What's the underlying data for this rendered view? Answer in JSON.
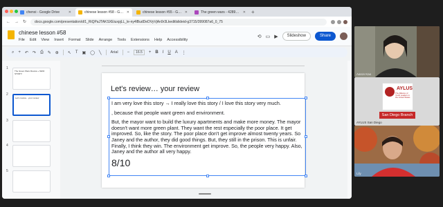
{
  "browser": {
    "tabs": [
      {
        "title": "chenxi - Google Drive",
        "color": "#4285f4"
      },
      {
        "title": "chinese lesson #58 - Google",
        "color": "#f4b400"
      },
      {
        "title": "chinese lesson #55 - Google",
        "color": "#f4b400"
      },
      {
        "title": "The green wars - 42891 [aw",
        "color": "#ab47bc"
      }
    ],
    "new_tab": "+",
    "url": "docs.google.com/presentation/d/1_RiQPaJTAKSXEiuxpjLL_le-ny4lBudDeDVyVjAn9r3Lkeditlslideid-g3715/399087a6_0_75"
  },
  "docs": {
    "title": "chinese lesson #58",
    "menus": [
      "File",
      "Edit",
      "View",
      "Insert",
      "Format",
      "Slide",
      "Arrange",
      "Tools",
      "Extensions",
      "Help",
      "Accessibility"
    ],
    "slideshow_label": "Slideshow",
    "share_label": "Share",
    "font_name": "Arial",
    "font_size": "16.5"
  },
  "filmstrip": [
    {
      "num": "1",
      "text": "The Green Wars Review + NEW STORY!"
    },
    {
      "num": "2",
      "text": "Let's review... your review"
    },
    {
      "num": "3",
      "text": ""
    },
    {
      "num": "4",
      "text": ""
    },
    {
      "num": "5",
      "text": ""
    }
  ],
  "slide": {
    "title": "Let's review… your review",
    "line1": "I am very love this story → I really love this story / I love this story very much.",
    "line2": ", because that people want green and environment.",
    "paragraph": "But, the mayor want to build the luxury apartments and make more money. The mayor doesn't want more green plant. They want the rest especially the poor place. It get improved. So, like the story. The poor place don't get improve almost twenty years. So Janey and the author, they did good things. But, they still in the prison. This is unfair. Finally, I think they win. The environment get improve. So, the people very happy. Also, Janey and the author all very happy.",
    "score": "8/10"
  },
  "participants": [
    {
      "name": "Aaron Kao"
    },
    {
      "name": "AYLUS San Diego",
      "logo_text": "AYLUS",
      "logo_sub": "The Alliance of Youth Leaders in the United States",
      "branch": "San Diego Branch"
    },
    {
      "name": "Lily"
    }
  ]
}
